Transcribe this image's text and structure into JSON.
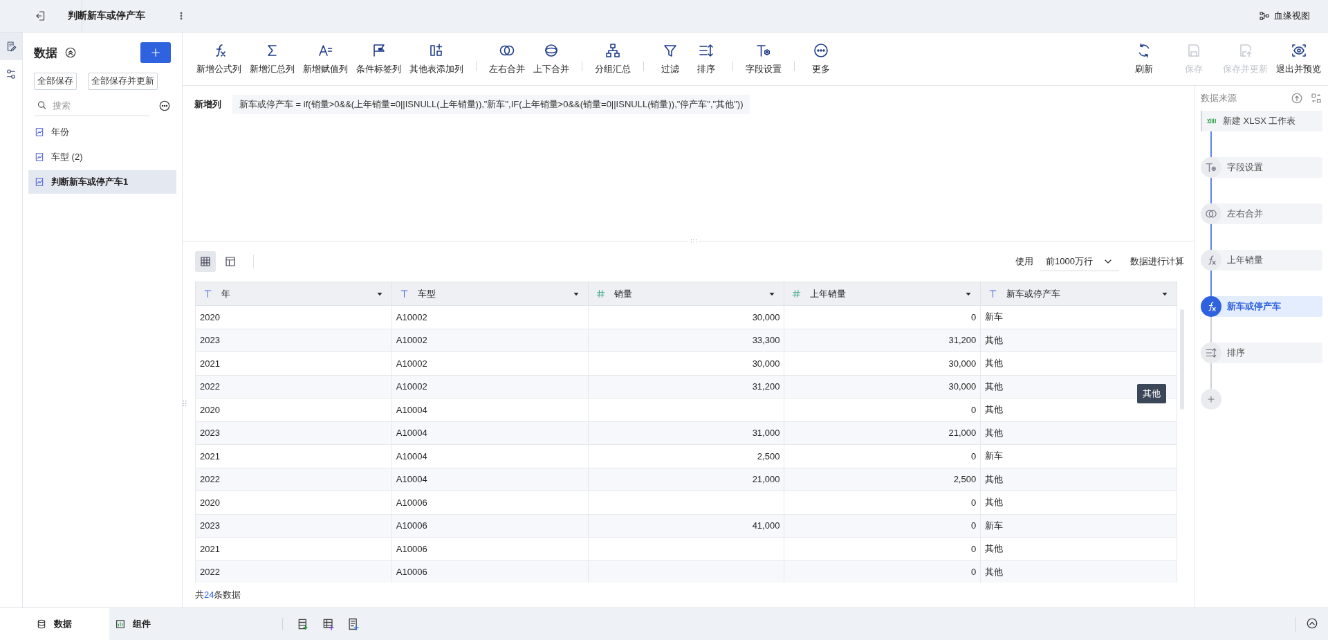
{
  "top_bar": {
    "title": "判断新车或停产车",
    "lineage_button": "血缘视图"
  },
  "left_panel": {
    "title": "数据",
    "buttons": [
      "全部保存",
      "全部保存并更新"
    ],
    "search": {
      "placeholder": "搜索"
    },
    "items": [
      {
        "label": "年份",
        "selected": false
      },
      {
        "label": "车型 (2)",
        "selected": false
      },
      {
        "label": "判断新车或停产车1",
        "selected": true
      }
    ]
  },
  "toolbar": {
    "tool_groups": [
      {
        "tools": [
          {
            "label": "新增公式列",
            "kind": "formula"
          },
          {
            "label": "新增汇总列",
            "kind": "sum"
          },
          {
            "label": "新增赋值列",
            "kind": "assign"
          },
          {
            "label": "条件标签列",
            "kind": "flag"
          },
          {
            "label": "其他表添加列",
            "kind": "addcol"
          }
        ]
      },
      {
        "tools": [
          {
            "label": "左右合并",
            "kind": "join-lr"
          },
          {
            "label": "上下合并",
            "kind": "join-ud"
          }
        ]
      },
      {
        "tools": [
          {
            "label": "分组汇总",
            "kind": "group"
          }
        ]
      },
      {
        "tools": [
          {
            "label": "过滤",
            "kind": "filter"
          },
          {
            "label": "排序",
            "kind": "sort"
          }
        ]
      },
      {
        "tools": [
          {
            "label": "字段设置",
            "kind": "field"
          }
        ]
      },
      {
        "tools": [
          {
            "label": "更多",
            "kind": "more"
          }
        ]
      }
    ],
    "right_tools": [
      {
        "label": "刷新",
        "kind": "refresh",
        "disabled": false
      },
      {
        "label": "保存",
        "kind": "save",
        "disabled": true
      },
      {
        "label": "保存并更新",
        "kind": "save-update",
        "disabled": true
      },
      {
        "label": "退出并预览",
        "kind": "preview",
        "disabled": false
      }
    ]
  },
  "formula_bar": {
    "label": "新增列",
    "formula": "新车或停产车 = if(销量>0&&(上年销量=0||ISNULL(上年销量)),\"新车\",IF(上年销量>0&&(销量=0||ISNULL(销量)),\"停产车\",\"其他\"))"
  },
  "table": {
    "view_modes": [
      {
        "kind": "grid",
        "selected": true
      },
      {
        "kind": "layout",
        "selected": false
      }
    ],
    "row_limit": {
      "prefix": "使用",
      "value": "前1000万行",
      "suffix": "数据进行计算"
    },
    "columns": [
      {
        "label": "年",
        "kind": "text"
      },
      {
        "label": "车型",
        "kind": "text"
      },
      {
        "label": "销量",
        "kind": "number"
      },
      {
        "label": "上年销量",
        "kind": "number"
      },
      {
        "label": "新车或停产车",
        "kind": "text"
      }
    ],
    "rows": [
      [
        "2020",
        "A10002",
        "30,000",
        "0",
        "新车"
      ],
      [
        "2023",
        "A10002",
        "33,300",
        "31,200",
        "其他"
      ],
      [
        "2021",
        "A10002",
        "30,000",
        "30,000",
        "其他"
      ],
      [
        "2022",
        "A10002",
        "31,200",
        "30,000",
        "其他"
      ],
      [
        "2020",
        "A10004",
        null,
        "0",
        "其他"
      ],
      [
        "2023",
        "A10004",
        "31,000",
        "21,000",
        "其他"
      ],
      [
        "2021",
        "A10004",
        "2,500",
        "0",
        "新车"
      ],
      [
        "2022",
        "A10004",
        "21,000",
        "2,500",
        "其他"
      ],
      [
        "2020",
        "A10006",
        null,
        "0",
        "其他"
      ],
      [
        "2023",
        "A10006",
        "41,000",
        "0",
        "新车"
      ],
      [
        "2021",
        "A10006",
        null,
        "0",
        "其他"
      ],
      [
        "2022",
        "A10006",
        null,
        "0",
        "其他"
      ]
    ],
    "tooltip": "其他",
    "footer": {
      "prefix": "共",
      "count": "24",
      "suffix": "条数据"
    }
  },
  "right_panel": {
    "title": "数据来源",
    "steps": [
      {
        "label": "新建 XLSX 工作表",
        "kind": "source",
        "selected": false
      },
      {
        "label": "字段设置",
        "kind": "field",
        "selected": false
      },
      {
        "label": "左右合并",
        "kind": "join-lr",
        "selected": false
      },
      {
        "label": "上年销量",
        "kind": "formula",
        "selected": false
      },
      {
        "label": "新车或停产车",
        "kind": "formula",
        "selected": true
      },
      {
        "label": "排序",
        "kind": "sort",
        "selected": false
      }
    ]
  },
  "bottom_bar": {
    "tabs": [
      {
        "label": "数据",
        "kind": "database",
        "selected": true
      },
      {
        "label": "组件",
        "kind": "chart",
        "selected": false
      }
    ]
  }
}
